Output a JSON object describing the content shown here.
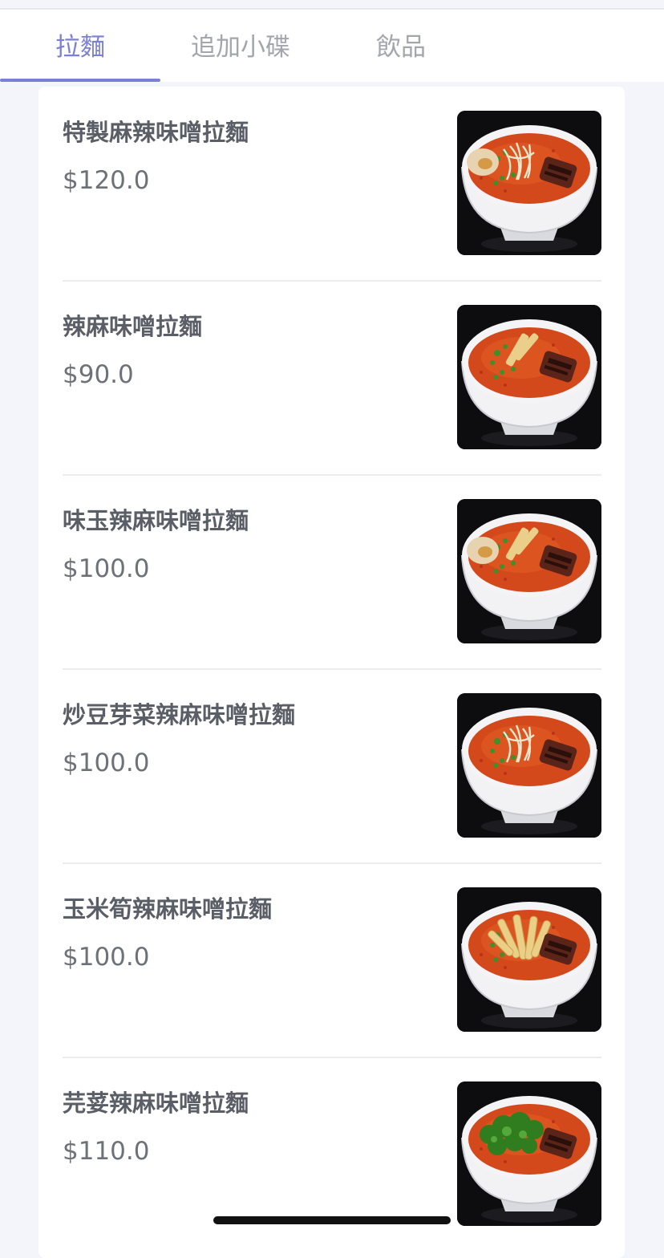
{
  "tabs": [
    {
      "label": "拉麵",
      "active": true
    },
    {
      "label": "追加小碟",
      "active": false
    },
    {
      "label": "飲品",
      "active": false
    }
  ],
  "menu_items": [
    {
      "name": "特製麻辣味噌拉麵",
      "price": "$120.0",
      "topping": "egg-sprouts-pork"
    },
    {
      "name": "辣麻味噌拉麵",
      "price": "$90.0",
      "topping": "greens-bamboo-pork"
    },
    {
      "name": "味玉辣麻味噌拉麵",
      "price": "$100.0",
      "topping": "egg-bamboo-pork"
    },
    {
      "name": "炒豆芽菜辣麻味噌拉麵",
      "price": "$100.0",
      "topping": "sprouts-pork"
    },
    {
      "name": "玉米筍辣麻味噌拉麵",
      "price": "$100.0",
      "topping": "baby-corn-pork"
    },
    {
      "name": "芫荽辣麻味噌拉麵",
      "price": "$110.0",
      "topping": "cilantro-pork"
    }
  ],
  "colors": {
    "accent": "#7b7fd6",
    "tab_inactive": "#a3a6ad",
    "item_name": "#5a5e66",
    "price": "#6d7178",
    "background": "#f4f5fb"
  }
}
